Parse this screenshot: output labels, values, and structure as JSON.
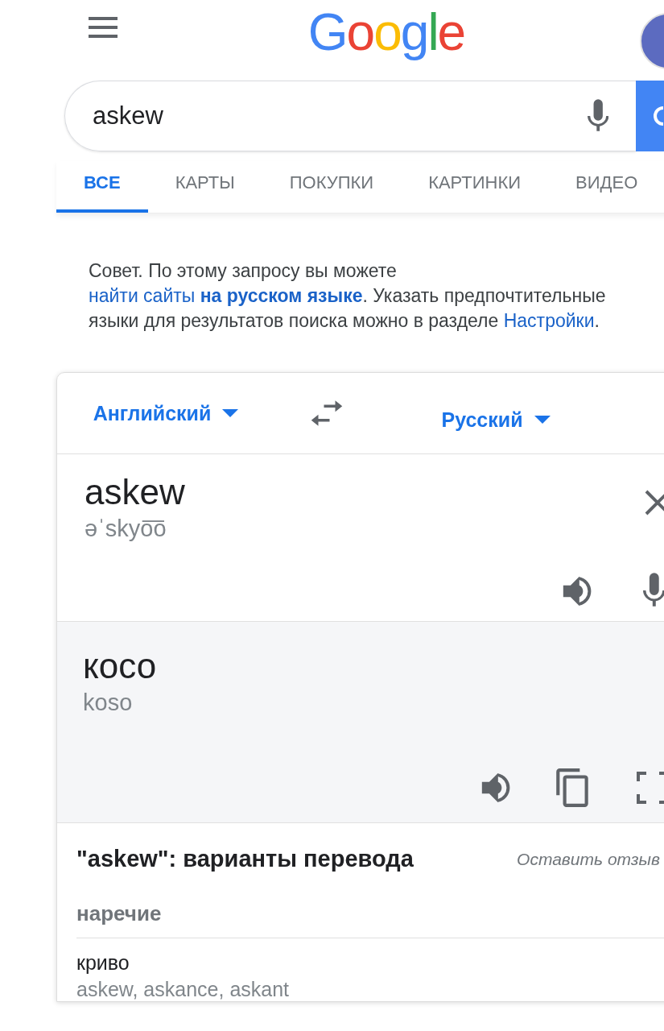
{
  "header": {
    "logo": "Google"
  },
  "search": {
    "value": "askew"
  },
  "tabs": [
    {
      "label": "ВСЕ",
      "selected": true
    },
    {
      "label": "КАРТЫ",
      "selected": false
    },
    {
      "label": "ПОКУПКИ",
      "selected": false
    },
    {
      "label": "КАРТИНКИ",
      "selected": false
    },
    {
      "label": "ВИДЕО",
      "selected": false
    }
  ],
  "tip": {
    "text": "Совет. По этому запросу вы можете ",
    "link": "найти сайты **на русском языке**",
    "text2": ". Указать предпочтительные языки для результатов поиска можно в разделе ",
    "settings_link": "Настройки",
    "text3": "."
  },
  "translator": {
    "source_language": "Английский",
    "target_language": "Русский",
    "source": {
      "text": "askew",
      "transcription": "əˈskyo͞o"
    },
    "target": {
      "text": "косо",
      "transliteration": "koso"
    },
    "variants": {
      "title": "\"askew\": варианты перевода",
      "feedback": "Оставить отзыв",
      "groups": [
        {
          "part_of_speech": "наречие",
          "entries": [
            {
              "word": "криво",
              "synonyms": "askew, askance, askant"
            }
          ]
        }
      ]
    }
  }
}
